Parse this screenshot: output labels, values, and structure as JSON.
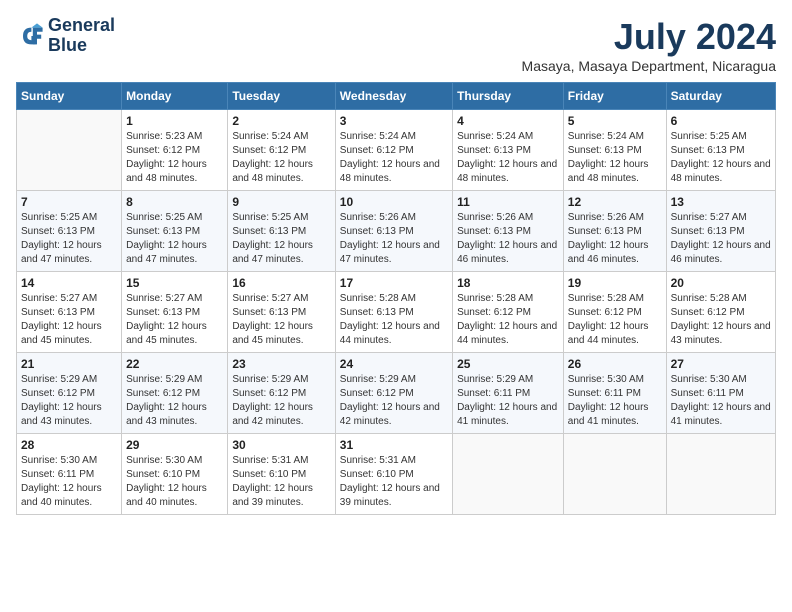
{
  "logo": {
    "line1": "General",
    "line2": "Blue"
  },
  "title": "July 2024",
  "subtitle": "Masaya, Masaya Department, Nicaragua",
  "headers": [
    "Sunday",
    "Monday",
    "Tuesday",
    "Wednesday",
    "Thursday",
    "Friday",
    "Saturday"
  ],
  "weeks": [
    [
      {
        "day": "",
        "sunrise": "",
        "sunset": "",
        "daylight": ""
      },
      {
        "day": "1",
        "sunrise": "Sunrise: 5:23 AM",
        "sunset": "Sunset: 6:12 PM",
        "daylight": "Daylight: 12 hours and 48 minutes."
      },
      {
        "day": "2",
        "sunrise": "Sunrise: 5:24 AM",
        "sunset": "Sunset: 6:12 PM",
        "daylight": "Daylight: 12 hours and 48 minutes."
      },
      {
        "day": "3",
        "sunrise": "Sunrise: 5:24 AM",
        "sunset": "Sunset: 6:12 PM",
        "daylight": "Daylight: 12 hours and 48 minutes."
      },
      {
        "day": "4",
        "sunrise": "Sunrise: 5:24 AM",
        "sunset": "Sunset: 6:13 PM",
        "daylight": "Daylight: 12 hours and 48 minutes."
      },
      {
        "day": "5",
        "sunrise": "Sunrise: 5:24 AM",
        "sunset": "Sunset: 6:13 PM",
        "daylight": "Daylight: 12 hours and 48 minutes."
      },
      {
        "day": "6",
        "sunrise": "Sunrise: 5:25 AM",
        "sunset": "Sunset: 6:13 PM",
        "daylight": "Daylight: 12 hours and 48 minutes."
      }
    ],
    [
      {
        "day": "7",
        "sunrise": "Sunrise: 5:25 AM",
        "sunset": "Sunset: 6:13 PM",
        "daylight": "Daylight: 12 hours and 47 minutes."
      },
      {
        "day": "8",
        "sunrise": "Sunrise: 5:25 AM",
        "sunset": "Sunset: 6:13 PM",
        "daylight": "Daylight: 12 hours and 47 minutes."
      },
      {
        "day": "9",
        "sunrise": "Sunrise: 5:25 AM",
        "sunset": "Sunset: 6:13 PM",
        "daylight": "Daylight: 12 hours and 47 minutes."
      },
      {
        "day": "10",
        "sunrise": "Sunrise: 5:26 AM",
        "sunset": "Sunset: 6:13 PM",
        "daylight": "Daylight: 12 hours and 47 minutes."
      },
      {
        "day": "11",
        "sunrise": "Sunrise: 5:26 AM",
        "sunset": "Sunset: 6:13 PM",
        "daylight": "Daylight: 12 hours and 46 minutes."
      },
      {
        "day": "12",
        "sunrise": "Sunrise: 5:26 AM",
        "sunset": "Sunset: 6:13 PM",
        "daylight": "Daylight: 12 hours and 46 minutes."
      },
      {
        "day": "13",
        "sunrise": "Sunrise: 5:27 AM",
        "sunset": "Sunset: 6:13 PM",
        "daylight": "Daylight: 12 hours and 46 minutes."
      }
    ],
    [
      {
        "day": "14",
        "sunrise": "Sunrise: 5:27 AM",
        "sunset": "Sunset: 6:13 PM",
        "daylight": "Daylight: 12 hours and 45 minutes."
      },
      {
        "day": "15",
        "sunrise": "Sunrise: 5:27 AM",
        "sunset": "Sunset: 6:13 PM",
        "daylight": "Daylight: 12 hours and 45 minutes."
      },
      {
        "day": "16",
        "sunrise": "Sunrise: 5:27 AM",
        "sunset": "Sunset: 6:13 PM",
        "daylight": "Daylight: 12 hours and 45 minutes."
      },
      {
        "day": "17",
        "sunrise": "Sunrise: 5:28 AM",
        "sunset": "Sunset: 6:13 PM",
        "daylight": "Daylight: 12 hours and 44 minutes."
      },
      {
        "day": "18",
        "sunrise": "Sunrise: 5:28 AM",
        "sunset": "Sunset: 6:12 PM",
        "daylight": "Daylight: 12 hours and 44 minutes."
      },
      {
        "day": "19",
        "sunrise": "Sunrise: 5:28 AM",
        "sunset": "Sunset: 6:12 PM",
        "daylight": "Daylight: 12 hours and 44 minutes."
      },
      {
        "day": "20",
        "sunrise": "Sunrise: 5:28 AM",
        "sunset": "Sunset: 6:12 PM",
        "daylight": "Daylight: 12 hours and 43 minutes."
      }
    ],
    [
      {
        "day": "21",
        "sunrise": "Sunrise: 5:29 AM",
        "sunset": "Sunset: 6:12 PM",
        "daylight": "Daylight: 12 hours and 43 minutes."
      },
      {
        "day": "22",
        "sunrise": "Sunrise: 5:29 AM",
        "sunset": "Sunset: 6:12 PM",
        "daylight": "Daylight: 12 hours and 43 minutes."
      },
      {
        "day": "23",
        "sunrise": "Sunrise: 5:29 AM",
        "sunset": "Sunset: 6:12 PM",
        "daylight": "Daylight: 12 hours and 42 minutes."
      },
      {
        "day": "24",
        "sunrise": "Sunrise: 5:29 AM",
        "sunset": "Sunset: 6:12 PM",
        "daylight": "Daylight: 12 hours and 42 minutes."
      },
      {
        "day": "25",
        "sunrise": "Sunrise: 5:29 AM",
        "sunset": "Sunset: 6:11 PM",
        "daylight": "Daylight: 12 hours and 41 minutes."
      },
      {
        "day": "26",
        "sunrise": "Sunrise: 5:30 AM",
        "sunset": "Sunset: 6:11 PM",
        "daylight": "Daylight: 12 hours and 41 minutes."
      },
      {
        "day": "27",
        "sunrise": "Sunrise: 5:30 AM",
        "sunset": "Sunset: 6:11 PM",
        "daylight": "Daylight: 12 hours and 41 minutes."
      }
    ],
    [
      {
        "day": "28",
        "sunrise": "Sunrise: 5:30 AM",
        "sunset": "Sunset: 6:11 PM",
        "daylight": "Daylight: 12 hours and 40 minutes."
      },
      {
        "day": "29",
        "sunrise": "Sunrise: 5:30 AM",
        "sunset": "Sunset: 6:10 PM",
        "daylight": "Daylight: 12 hours and 40 minutes."
      },
      {
        "day": "30",
        "sunrise": "Sunrise: 5:31 AM",
        "sunset": "Sunset: 6:10 PM",
        "daylight": "Daylight: 12 hours and 39 minutes."
      },
      {
        "day": "31",
        "sunrise": "Sunrise: 5:31 AM",
        "sunset": "Sunset: 6:10 PM",
        "daylight": "Daylight: 12 hours and 39 minutes."
      },
      {
        "day": "",
        "sunrise": "",
        "sunset": "",
        "daylight": ""
      },
      {
        "day": "",
        "sunrise": "",
        "sunset": "",
        "daylight": ""
      },
      {
        "day": "",
        "sunrise": "",
        "sunset": "",
        "daylight": ""
      }
    ]
  ]
}
